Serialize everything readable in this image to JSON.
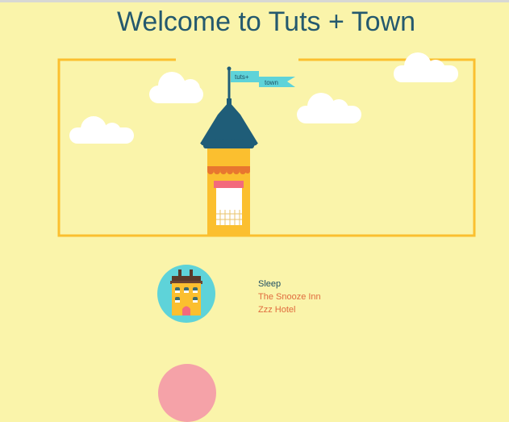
{
  "page": {
    "title": "Welcome to Tuts + Town"
  },
  "hero": {
    "flag_text_1": "tuts+",
    "flag_text_2": "town"
  },
  "colors": {
    "background": "#faf4aa",
    "title": "#24596e",
    "frame": "#fbbf2f",
    "roof": "#1f5d78",
    "flag": "#5ed3d9",
    "awning": "#f36a7c",
    "link": "#e06b3e",
    "next_circle": "#f5a2a8"
  },
  "categories": [
    {
      "heading": "Sleep",
      "icon": "hotel-icon",
      "links": [
        "The Snooze Inn",
        "Zzz Hotel"
      ]
    }
  ]
}
